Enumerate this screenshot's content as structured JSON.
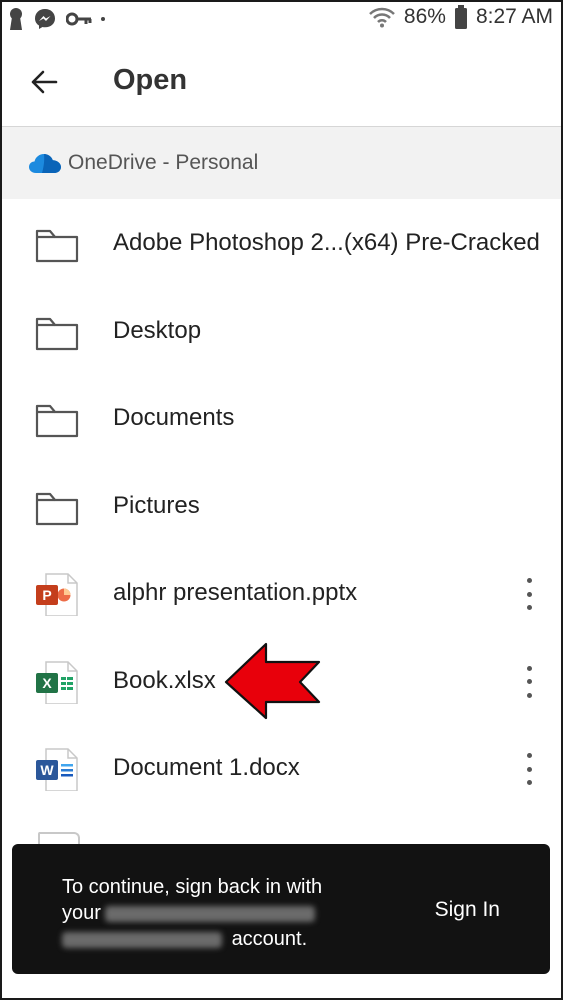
{
  "status_bar": {
    "battery": "86%",
    "time": "8:27 AM",
    "icons": [
      "keyhole-icon",
      "messenger-icon",
      "key-icon",
      "wifi-icon",
      "battery-icon"
    ]
  },
  "header": {
    "title": "Open",
    "back_icon": "arrow-left-icon"
  },
  "location": {
    "label": "OneDrive - Personal",
    "icon": "cloud-icon",
    "color": "#0078d4"
  },
  "files": [
    {
      "name": "Adobe Photoshop 2...(x64) Pre-Cracked",
      "type": "folder"
    },
    {
      "name": "Desktop",
      "type": "folder"
    },
    {
      "name": "Documents",
      "type": "folder"
    },
    {
      "name": "Pictures",
      "type": "folder"
    },
    {
      "name": "alphr presentation.pptx",
      "type": "pptx",
      "color": "#c43e1c"
    },
    {
      "name": "Book.xlsx",
      "type": "xlsx",
      "color": "#217346"
    },
    {
      "name": "Document 1.docx",
      "type": "docx",
      "color": "#2b579a"
    }
  ],
  "snackbar": {
    "line1": "To continue, sign back in with",
    "line2_prefix": "your",
    "line3_suffix": "account.",
    "action": "Sign In"
  },
  "annotation": {
    "arrow_color": "#e8000b"
  }
}
